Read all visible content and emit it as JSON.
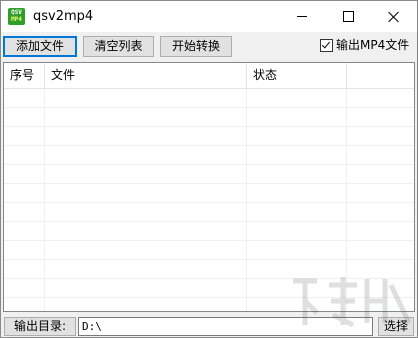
{
  "window": {
    "title": "qsv2mp4",
    "icon": {
      "line1": "QSV",
      "line2": "MP4"
    },
    "controls": [
      "minimize-icon",
      "maximize-icon",
      "close-icon"
    ]
  },
  "toolbar": {
    "add_file": "添加文件",
    "clear_list": "清空列表",
    "start_convert": "开始转换",
    "output_mp4_label": "输出MP4文件",
    "output_mp4_checked": true
  },
  "list": {
    "columns": [
      "序号",
      "文件",
      "状态",
      ""
    ],
    "rows": []
  },
  "footer": {
    "output_dir_label": "输出目录:",
    "output_dir_value": "D:\\",
    "choose_button": "选择"
  },
  "colors": {
    "titlebar": "#ffffff",
    "window_bg": "#f0f0f0",
    "focus_border": "#0078d7",
    "app_icon": "#2f9e2a"
  }
}
